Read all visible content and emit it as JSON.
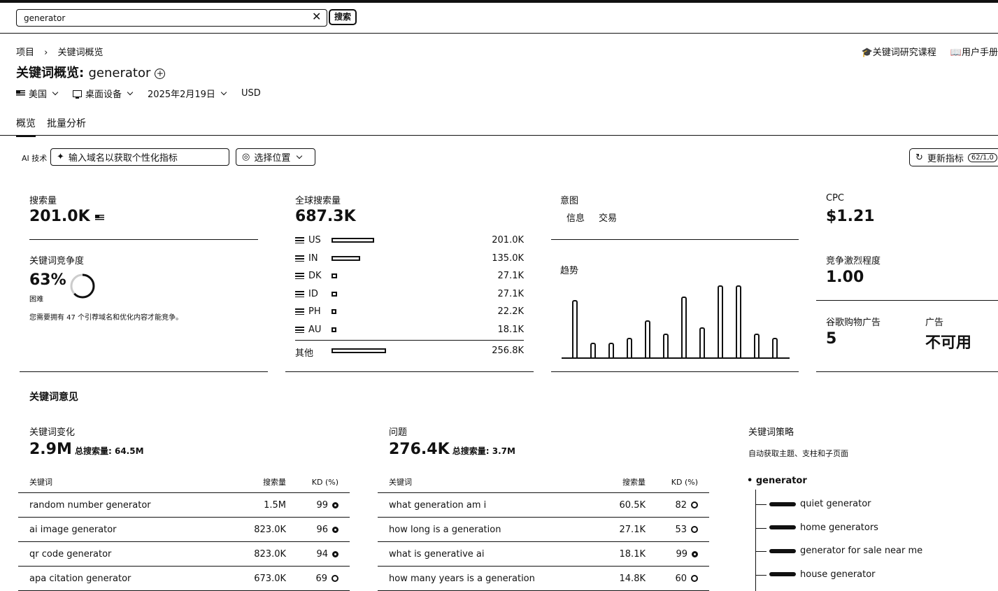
{
  "search": {
    "query": "generator",
    "button": "搜索"
  },
  "breadcrumb": {
    "root": "项目",
    "current": "关键词概览"
  },
  "header": {
    "title_prefix": "关键词概览: ",
    "keyword": "generator",
    "links": [
      "关键词研究课程",
      "用户手册"
    ]
  },
  "filters": {
    "country": "美国",
    "device": "桌面设备",
    "date": "2025年2月19日",
    "currency": "USD"
  },
  "tabs": [
    "概览",
    "批量分析"
  ],
  "toolbar": {
    "ai_label": "AI 技术",
    "domain_placeholder": "输入域名以获取个性化指标",
    "location": "选择位置",
    "update": "更新指标",
    "quota": "62/1,0"
  },
  "volume": {
    "label": "搜索量",
    "value": "201.0K"
  },
  "difficulty": {
    "label": "关键词竞争度",
    "value": "63%",
    "level": "困难",
    "percent": 63,
    "note": "您需要拥有 47 个引荐域名和优化内容才能竞争。"
  },
  "global": {
    "label": "全球搜索量",
    "value": "687.3K",
    "countries": [
      {
        "code": "US",
        "value": "201.0K",
        "num": 201.0
      },
      {
        "code": "IN",
        "value": "135.0K",
        "num": 135.0
      },
      {
        "code": "DK",
        "value": "27.1K",
        "num": 27.1
      },
      {
        "code": "ID",
        "value": "27.1K",
        "num": 27.1
      },
      {
        "code": "PH",
        "value": "22.2K",
        "num": 22.2
      },
      {
        "code": "AU",
        "value": "18.1K",
        "num": 18.1
      }
    ],
    "other": {
      "label": "其他",
      "value": "256.8K",
      "num": 256.8
    }
  },
  "intent": {
    "label": "意图",
    "tags": [
      "信息",
      "交易"
    ]
  },
  "trend": {
    "label": "趋势",
    "values": [
      0.79,
      0.2,
      0.2,
      0.27,
      0.51,
      0.33,
      0.84,
      0.41,
      0.99,
      0.99,
      0.33,
      0.27
    ]
  },
  "cpc": {
    "label": "CPC",
    "value": "$1.21"
  },
  "competition": {
    "label": "竞争激烈程度",
    "value": "1.00"
  },
  "shopping": {
    "label": "谷歌购物广告",
    "value": "5"
  },
  "ads": {
    "label": "广告",
    "value": "不可用"
  },
  "ideas": {
    "title": "关键词意见"
  },
  "variations": {
    "label": "关键词变化",
    "value": "2.9M",
    "total_label": "总搜索量:",
    "total": "64.5M",
    "headers": [
      "关键词",
      "搜索量",
      "KD (%)"
    ],
    "rows": [
      {
        "kw": "random number generator",
        "vol": "1.5M",
        "kd": "99"
      },
      {
        "kw": "ai image generator",
        "vol": "823.0K",
        "kd": "96"
      },
      {
        "kw": "qr code generator",
        "vol": "823.0K",
        "kd": "94"
      },
      {
        "kw": "apa citation generator",
        "vol": "673.0K",
        "kd": "69"
      }
    ]
  },
  "questions": {
    "label": "问题",
    "value": "276.4K",
    "total_label": "总搜索量:",
    "total": "3.7M",
    "headers": [
      "关键词",
      "搜索量",
      "KD (%)"
    ],
    "rows": [
      {
        "kw": "what generation am i",
        "vol": "60.5K",
        "kd": "82"
      },
      {
        "kw": "how long is a generation",
        "vol": "27.1K",
        "kd": "53"
      },
      {
        "kw": "what is generative ai",
        "vol": "18.1K",
        "kd": "99"
      },
      {
        "kw": "how many years is a generation",
        "vol": "14.8K",
        "kd": "60"
      }
    ]
  },
  "strategy": {
    "label": "关键词策略",
    "subtitle": "自动获取主题、支柱和子页面",
    "root": "generator",
    "items": [
      "quiet generator",
      "home generators",
      "generator for sale near me",
      "house generator"
    ]
  }
}
